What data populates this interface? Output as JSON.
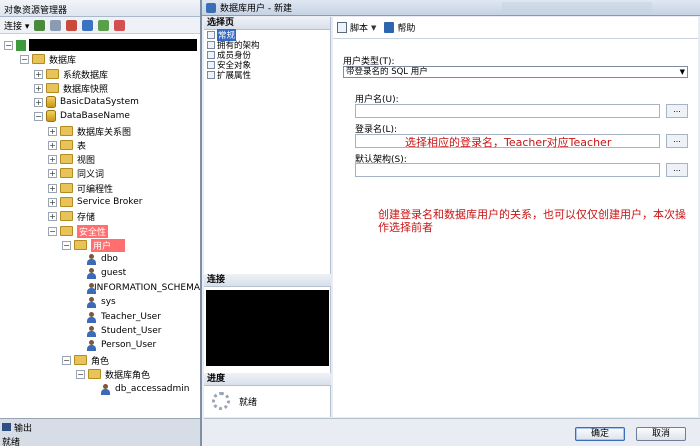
{
  "object_explorer": {
    "title": "对象资源管理器",
    "toolbar": {
      "connect_label": "连接 ▾"
    },
    "tree": [
      {
        "label": "数据库"
      },
      {
        "label": "系统数据库"
      },
      {
        "label": "数据库快照"
      },
      {
        "label": "BasicDataSystem"
      },
      {
        "label": "DataBaseName"
      },
      {
        "label": "数据库关系图"
      },
      {
        "label": "表"
      },
      {
        "label": "视图"
      },
      {
        "label": "同义词"
      },
      {
        "label": "可编程性"
      },
      {
        "label": "Service Broker"
      },
      {
        "label": "存储"
      },
      {
        "label": "安全性"
      },
      {
        "label": "用户"
      },
      {
        "label": "dbo"
      },
      {
        "label": "guest"
      },
      {
        "label": "INFORMATION_SCHEMA"
      },
      {
        "label": "sys"
      },
      {
        "label": "Teacher_User"
      },
      {
        "label": "Student_User"
      },
      {
        "label": "Person_User"
      },
      {
        "label": "角色"
      },
      {
        "label": "数据库角色"
      },
      {
        "label": "db_accessadmin"
      }
    ],
    "output_tab": "输出",
    "status": "就绪"
  },
  "dialog": {
    "title": "数据库用户 - 新建",
    "left_pane": {
      "header": "选择页",
      "pages": [
        "常规",
        "拥有的架构",
        "成员身份",
        "安全对象",
        "扩展属性"
      ],
      "selected_index": 0,
      "connection_header": "连接",
      "progress_header": "进度",
      "progress_status": "就绪"
    },
    "toolbar": {
      "script_label": "脚本",
      "help_label": "帮助"
    },
    "form": {
      "user_type_label": "用户类型(T):",
      "user_type_value": "带登录名的 SQL 用户",
      "user_name_label": "用户名(U):",
      "user_name_value": "",
      "login_name_label": "登录名(L):",
      "login_name_value": "",
      "default_schema_label": "默认架构(S):",
      "default_schema_value": "",
      "browse_label": "..."
    },
    "annotations": {
      "login_note": "选择相应的登录名，Teacher对应Teacher",
      "main_note_line1": "创建登录名和数据库用户的关系，也可以仅仅创建用户，本次操",
      "main_note_line2": "作选择前者"
    },
    "buttons": {
      "ok": "确定",
      "cancel": "取消"
    }
  },
  "colors": {
    "highlight": "#ff6f6f",
    "annotation": "#c81414",
    "selection": "#316ac5"
  }
}
